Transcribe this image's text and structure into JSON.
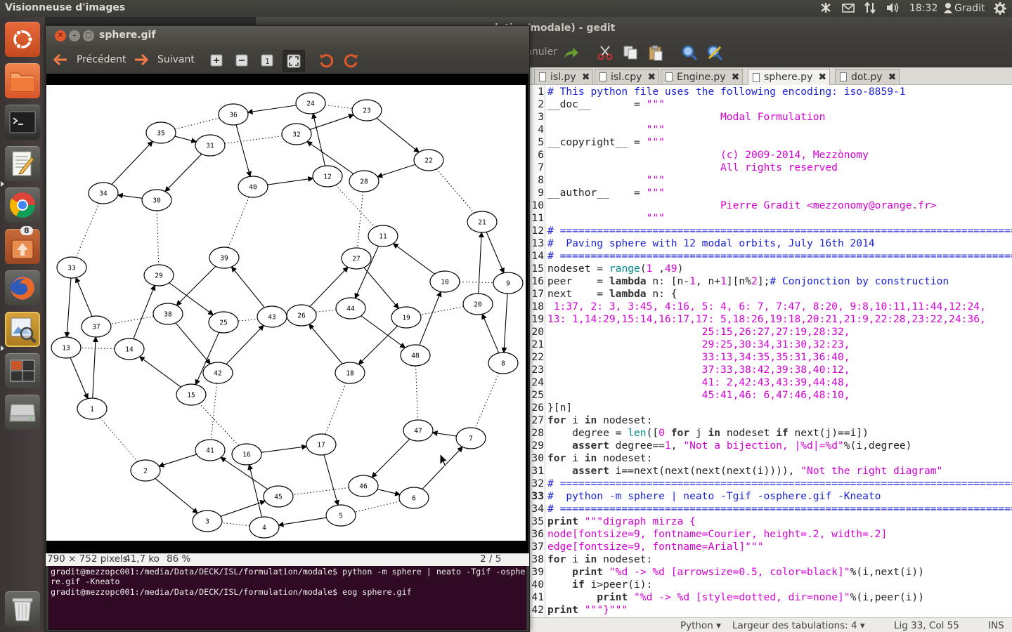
{
  "panel": {
    "app_title": "Visionneuse d'images",
    "time": "18:32",
    "user": "Gradit"
  },
  "launcher": {
    "files_badge": "8",
    "items": [
      "dash",
      "files",
      "terminal",
      "text-editor",
      "chrome",
      "software-updater",
      "firefox",
      "image-viewer",
      "workspaces",
      "disk",
      "trash"
    ]
  },
  "gedit": {
    "title": "ulation/modale) - gedit",
    "undo_label": "nnuler",
    "tabs": [
      "isl.py",
      "isl.cpy",
      "Engine.py",
      "sphere.py",
      "dot.py"
    ],
    "active_tab": "sphere.py",
    "status": {
      "language": "Python ▾",
      "tab_width": "Largeur des tabulations: 4 ▾",
      "position": "Lig 33, Col 55",
      "mode": "INS"
    },
    "current_line": 33
  },
  "eog": {
    "title": "sphere.gif",
    "prev_label": "Précédent",
    "next_label": "Suivant",
    "status": {
      "dims": "790 × 752 pixels",
      "size": "41,7 ko",
      "zoom": "86 %",
      "page": "2 / 5"
    }
  },
  "terminal": {
    "lines": [
      "gradit@mezzopc001:/media/Data/DECK/ISL/formulation/modale$ python -m sphere | neato -Tgif -ospher",
      "re.gif -Kneato",
      "gradit@mezzopc001:/media/Data/DECK/ISL/formulation/modale$ eog sphere.gif"
    ]
  },
  "code_lines": [
    [
      [
        "cm",
        "# This python file uses the following encoding: iso-8859-1"
      ]
    ],
    [
      [
        "",
        "__doc__       = "
      ],
      [
        "st",
        "\"\"\""
      ]
    ],
    [
      [
        "st",
        "                            Modal Formulation"
      ]
    ],
    [
      [
        "st",
        "                \"\"\""
      ]
    ],
    [
      [
        "",
        "__copyright__ = "
      ],
      [
        "st",
        "\"\"\""
      ]
    ],
    [
      [
        "st",
        "                            (c) 2009-2014, Mezzònomy"
      ]
    ],
    [
      [
        "st",
        "                            All rights reserved"
      ]
    ],
    [
      [
        "st",
        "                \"\"\""
      ]
    ],
    [
      [
        "",
        "__author__    = "
      ],
      [
        "st",
        "\"\"\""
      ]
    ],
    [
      [
        "st",
        "                            Pierre Gradit <mezzonomy@orange.fr>"
      ]
    ],
    [
      [
        "st",
        "                \"\"\""
      ]
    ],
    [
      [
        "cm",
        "# =============================================================================="
      ]
    ],
    [
      [
        "cm",
        "#  Paving sphere with 12 modal orbits, July 16th 2014"
      ]
    ],
    [
      [
        "cm",
        "# =============================================================================="
      ]
    ],
    [
      [
        "",
        "nodeset = "
      ],
      [
        "bi",
        "range"
      ],
      [
        "",
        "("
      ],
      [
        "st",
        "1"
      ],
      [
        "",
        " ,"
      ],
      [
        "st",
        "49"
      ],
      [
        "",
        ")"
      ]
    ],
    [
      [
        "",
        "peer    = "
      ],
      [
        "kw",
        "lambda"
      ],
      [
        "",
        " n: [n-"
      ],
      [
        "st",
        "1"
      ],
      [
        "",
        ", n+"
      ],
      [
        "st",
        "1"
      ],
      [
        "",
        "][n%"
      ],
      [
        "st",
        "2"
      ],
      [
        "",
        "];"
      ],
      [
        "cm",
        "# Conjonction by construction"
      ]
    ],
    [
      [
        "",
        "next    = "
      ],
      [
        "kw",
        "lambda"
      ],
      [
        "",
        " n: {"
      ]
    ],
    [
      [
        "st",
        " 1:37, 2: 3, 3:45, 4:16, 5: 4, 6: 7, 7:47, 8:20, 9:8,10:11,11:44,12:24,"
      ]
    ],
    [
      [
        "st",
        "13: 1,14:29,15:14,16:17,17: 5,18:26,19:18,20:21,21:9,22:28,23:22,24:36,"
      ]
    ],
    [
      [
        "st",
        "                         25:15,26:27,27:19,28:32,"
      ]
    ],
    [
      [
        "st",
        "                         29:25,30:34,31:30,32:23,"
      ]
    ],
    [
      [
        "st",
        "                         33:13,34:35,35:31,36:40,"
      ]
    ],
    [
      [
        "st",
        "                         37:33,38:42,39:38,40:12,"
      ]
    ],
    [
      [
        "st",
        "                         41: 2,42:43,43:39,44:48,"
      ]
    ],
    [
      [
        "st",
        "                         45:41,46: 6,47:46,48:10,"
      ]
    ],
    [
      [
        "",
        "}[n]"
      ]
    ],
    [
      [
        "kw",
        "for"
      ],
      [
        "",
        " i "
      ],
      [
        "kw",
        "in"
      ],
      [
        "",
        " nodeset:"
      ]
    ],
    [
      [
        "",
        "    degree = "
      ],
      [
        "bi",
        "len"
      ],
      [
        "",
        "(["
      ],
      [
        "st",
        "0"
      ],
      [
        "",
        " "
      ],
      [
        "kw",
        "for"
      ],
      [
        "",
        " j "
      ],
      [
        "kw",
        "in"
      ],
      [
        "",
        " nodeset "
      ],
      [
        "kw",
        "if"
      ],
      [
        "",
        " next(j)==i])"
      ]
    ],
    [
      [
        "",
        "    "
      ],
      [
        "kw",
        "assert"
      ],
      [
        "",
        " degree=="
      ],
      [
        "st",
        "1"
      ],
      [
        "",
        ", "
      ],
      [
        "st",
        "\"Not a bijection, |%d|=%d\""
      ],
      [
        "",
        "%(i,degree)"
      ]
    ],
    [
      [
        "kw",
        "for"
      ],
      [
        "",
        " i "
      ],
      [
        "kw",
        "in"
      ],
      [
        "",
        " nodeset:"
      ]
    ],
    [
      [
        "",
        "    "
      ],
      [
        "kw",
        "assert"
      ],
      [
        "",
        " i==next(next(next(next(i)))), "
      ],
      [
        "st",
        "\"Not the right diagram\""
      ]
    ],
    [
      [
        "cm",
        "# =============================================================================="
      ]
    ],
    [
      [
        "cm",
        "#  python -m sphere | neato -Tgif -osphere.gif -Kneato"
      ]
    ],
    [
      [
        "cm",
        "# =============================================================================="
      ]
    ],
    [
      [
        "kw",
        "print"
      ],
      [
        "",
        " "
      ],
      [
        "st",
        "\"\"\"digraph mirza {"
      ]
    ],
    [
      [
        "st",
        "node[fontsize=9, fontname=Courier, height=.2, width=.2]"
      ]
    ],
    [
      [
        "st",
        "edge[fontsize=9, fontname=Arial]\"\"\""
      ]
    ],
    [
      [
        "kw",
        "for"
      ],
      [
        "",
        " i "
      ],
      [
        "kw",
        "in"
      ],
      [
        "",
        " nodeset:"
      ]
    ],
    [
      [
        "",
        "    "
      ],
      [
        "kw",
        "print"
      ],
      [
        "",
        " "
      ],
      [
        "st",
        "\"%d -> %d [arrowsize=0.5, color=black]\""
      ],
      [
        "",
        "%(i,next(i))"
      ]
    ],
    [
      [
        "",
        "    "
      ],
      [
        "kw",
        "if"
      ],
      [
        "",
        " i>peer(i):"
      ]
    ],
    [
      [
        "",
        "        "
      ],
      [
        "kw",
        "print"
      ],
      [
        "",
        " "
      ],
      [
        "st",
        "\"%d -> %d [style=dotted, dir=none]\""
      ],
      [
        "",
        "%(i,peer(i))"
      ]
    ],
    [
      [
        "kw",
        "print"
      ],
      [
        "",
        " "
      ],
      [
        "st",
        "\"\"\"}\"\"\""
      ]
    ]
  ],
  "graph": {
    "nodes": [
      {
        "id": "1"
      },
      {
        "id": "2"
      },
      {
        "id": "3"
      },
      {
        "id": "4"
      },
      {
        "id": "5"
      },
      {
        "id": "6"
      },
      {
        "id": "7"
      },
      {
        "id": "8"
      },
      {
        "id": "9"
      },
      {
        "id": "10"
      },
      {
        "id": "11"
      },
      {
        "id": "12"
      },
      {
        "id": "13"
      },
      {
        "id": "14"
      },
      {
        "id": "15"
      },
      {
        "id": "16"
      },
      {
        "id": "17"
      },
      {
        "id": "18"
      },
      {
        "id": "19"
      },
      {
        "id": "20"
      },
      {
        "id": "21"
      },
      {
        "id": "22"
      },
      {
        "id": "23"
      },
      {
        "id": "24"
      },
      {
        "id": "25"
      },
      {
        "id": "26"
      },
      {
        "id": "27"
      },
      {
        "id": "28"
      },
      {
        "id": "29"
      },
      {
        "id": "30"
      },
      {
        "id": "31"
      },
      {
        "id": "32"
      },
      {
        "id": "33"
      },
      {
        "id": "34"
      },
      {
        "id": "35"
      },
      {
        "id": "36"
      },
      {
        "id": "37"
      },
      {
        "id": "38"
      },
      {
        "id": "39"
      },
      {
        "id": "40"
      },
      {
        "id": "41"
      },
      {
        "id": "42"
      },
      {
        "id": "43"
      },
      {
        "id": "44"
      },
      {
        "id": "45"
      },
      {
        "id": "46"
      },
      {
        "id": "47"
      },
      {
        "id": "48"
      }
    ],
    "next": {
      "1": 37,
      "2": 3,
      "3": 45,
      "4": 16,
      "5": 4,
      "6": 7,
      "7": 47,
      "8": 20,
      "9": 8,
      "10": 11,
      "11": 44,
      "12": 24,
      "13": 1,
      "14": 29,
      "15": 14,
      "16": 17,
      "17": 5,
      "18": 26,
      "19": 18,
      "20": 21,
      "21": 9,
      "22": 28,
      "23": 22,
      "24": 36,
      "25": 15,
      "26": 27,
      "27": 19,
      "28": 32,
      "29": 25,
      "30": 34,
      "31": 30,
      "32": 23,
      "33": 13,
      "34": 35,
      "35": 31,
      "36": 40,
      "37": 33,
      "38": 42,
      "39": 38,
      "40": 12,
      "41": 2,
      "42": 43,
      "43": 39,
      "44": 48,
      "45": 41,
      "46": 6,
      "47": 46,
      "48": 10
    }
  },
  "colors": {
    "panel_bg": "#3c3b37",
    "launcher_bg": "#403838",
    "terminal_bg": "#300a24",
    "comment": "#1a22d8",
    "string": "#d600d6",
    "builtin": "#008a8c",
    "accent_orange": "#f07746"
  }
}
